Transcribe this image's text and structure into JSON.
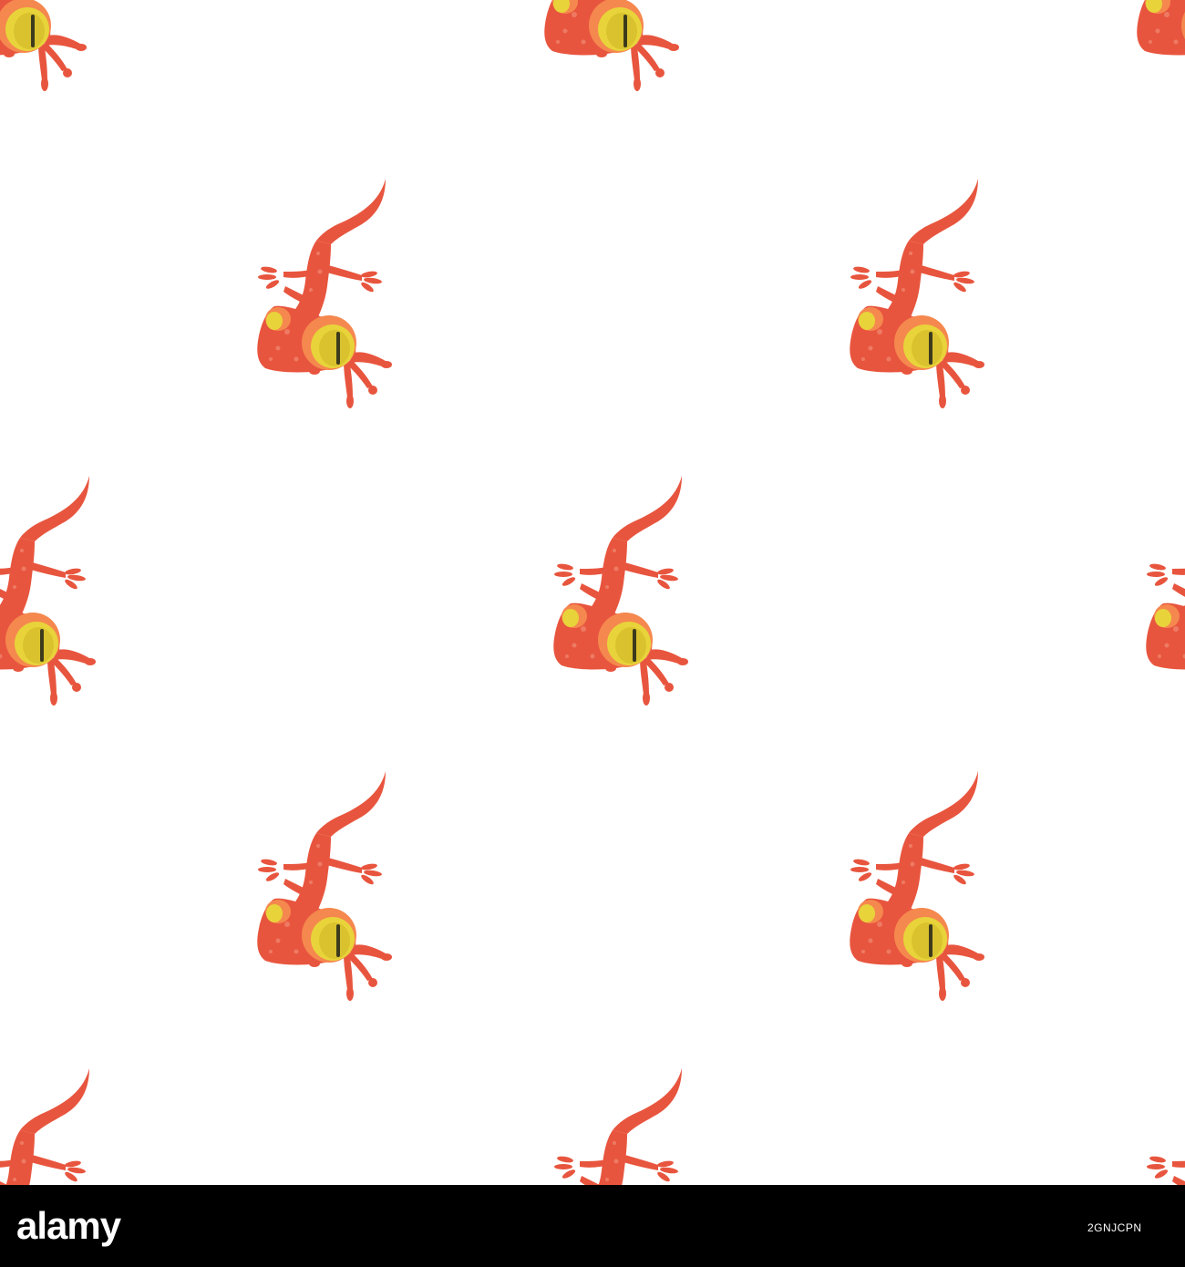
{
  "pattern": {
    "subject": "gecko-lizard",
    "colors": {
      "background": "#ffffff",
      "body": "#e8553e",
      "body_light": "#f0674e",
      "body_spots": "#ee7a63",
      "eye_ring": "#f5884e",
      "eye": "#e8d43a",
      "eye_inner": "#d9c22e",
      "pupil": "#3d3a1c"
    }
  },
  "footer": {
    "background": "#000000",
    "logo_text": "alamy",
    "image_id": "2GNJCPN"
  }
}
